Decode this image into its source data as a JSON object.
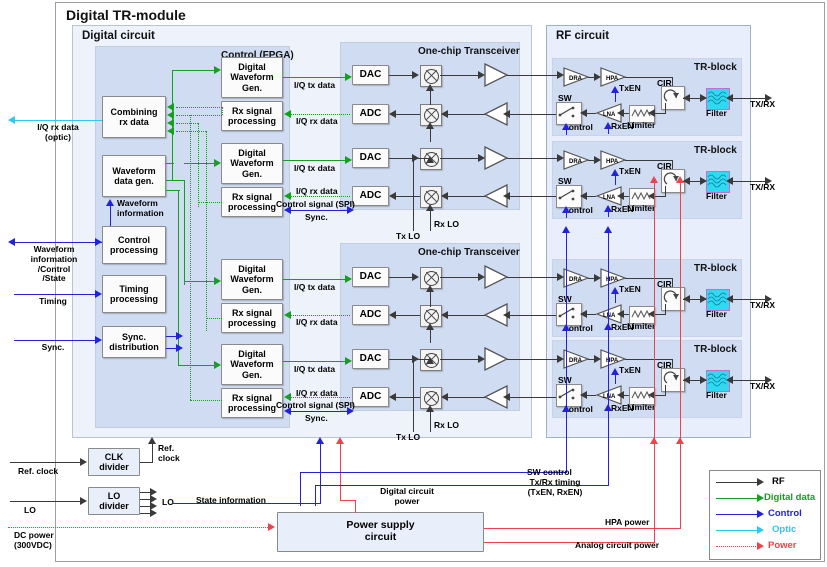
{
  "diagram": {
    "title": "Digital TR-module",
    "sections": {
      "digital_circuit": "Digital circuit",
      "control_fpga": "Control (FPGA)",
      "transceiver": "One-chip Transceiver",
      "rf_circuit": "RF circuit",
      "tr_block": "TR-block"
    }
  },
  "digital_blocks": {
    "combining_rx": "Combining\nrx data",
    "combining_rx_l1": "Combining",
    "combining_rx_l2": "rx data",
    "waveform_gen_l1": "Waveform",
    "waveform_gen_l2": "data gen.",
    "control_proc_l1": "Control",
    "control_proc_l2": "processing",
    "timing_proc_l1": "Timing",
    "timing_proc_l2": "processing",
    "sync_dist_l1": "Sync.",
    "sync_dist_l2": "distribution",
    "dwg_l1": "Digital",
    "dwg_l2": "Waveform",
    "dwg_l3": "Gen.",
    "rxsp_l1": "Rx signal",
    "rxsp_l2": "processing"
  },
  "transceiver_blocks": {
    "dac": "DAC",
    "adc": "ADC"
  },
  "rf_blocks": {
    "dra": "DRA",
    "hpa": "HPA",
    "lna": "LNA",
    "sw": "SW",
    "limiter": "Limiter",
    "cir": "CIR",
    "filter": "Filter"
  },
  "bottom_blocks": {
    "clk_divider_l1": "CLK",
    "clk_divider_l2": "divider",
    "lo_divider_l1": "LO",
    "lo_divider_l2": "divider",
    "power_supply_l1": "Power supply",
    "power_supply_l2": "circuit"
  },
  "wire_labels": {
    "iq_tx": "I/Q tx data",
    "iq_rx": "I/Q rx data",
    "control_spi": "Control signal (SPI)",
    "sync": "Sync.",
    "tx_lo": "Tx LO",
    "rx_lo": "Rx LO",
    "txen": "TxEN",
    "rxen": "RxEN",
    "control": "control",
    "txrx": "TX/RX",
    "waveform_info": "Waveform\ninformation",
    "waveform_info_l1": "Waveform",
    "waveform_info_l2": "information",
    "iq_rx_optic_l1": "I/Q rx data",
    "iq_rx_optic_l2": "(optic)",
    "wf_ctrl_state_l1": "Waveform",
    "wf_ctrl_state_l2": "information",
    "wf_ctrl_state_l3": "/Control",
    "wf_ctrl_state_l4": "/State",
    "timing_in": "Timing",
    "sync_in": "Sync.",
    "ref_clock_in": "Ref. clock",
    "lo_in": "LO",
    "dc_power_l1": "DC power",
    "dc_power_l2": "(300VDC)",
    "ref_clock_l1": "Ref.",
    "ref_clock_l2": "clock",
    "lo_out": "LO",
    "state_information": "State information",
    "digital_circuit_power_l1": "Digital circuit",
    "digital_circuit_power_l2": "power",
    "sw_control": "SW control",
    "txrx_timing_l1": "Tx/Rx timing",
    "txrx_timing_l2": "(TxEN, RxEN)",
    "hpa_power": "HPA power",
    "analog_circuit_power": "Analog circuit power"
  },
  "legend": {
    "items": [
      {
        "label": "RF",
        "color": "#3a3a3a",
        "style": "solid"
      },
      {
        "label": "Digital data",
        "color": "#14a01e",
        "style": "solid"
      },
      {
        "label": "Control",
        "color": "#2222dd",
        "style": "solid"
      },
      {
        "label": "Optic",
        "color": "#2ec8f5",
        "style": "solid"
      },
      {
        "label": "Power",
        "color": "#f0424a",
        "style": "dotted"
      }
    ]
  },
  "colors": {
    "rf": "#3a3a3a",
    "digital_data": "#14a01e",
    "control": "#2222dd",
    "optic": "#2ec8f5",
    "power": "#f0424a",
    "panel_light": "#eef3fb",
    "panel_mid": "#cfdcf2",
    "panel_rf": "#e8eefb"
  }
}
